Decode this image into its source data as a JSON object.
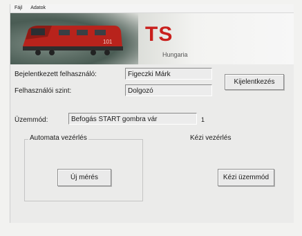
{
  "menu": {
    "items": [
      "Fájl",
      "Adatok"
    ]
  },
  "banner": {
    "logo_text": "TS",
    "subtitle": "Hungaria",
    "train_number": "101"
  },
  "user": {
    "user_label": "Bejelentkezett felhasználó:",
    "user_value": "Figeczki Márk",
    "level_label": "Felhasználói szint:",
    "level_value": "Dolgozó",
    "logout_label": "Kijelentkezés"
  },
  "mode": {
    "label": "Üzemmód:",
    "value": "Befogás START gombra vár",
    "number": "1"
  },
  "auto_group": {
    "title": "Automata vezérlés",
    "new_measure_label": "Új mérés"
  },
  "manual_group": {
    "title": "Kézi vezérlés",
    "manual_mode_label": "Kézi üzemmód"
  },
  "colors": {
    "logo_red": "#c9201d",
    "train_red": "#b8231c"
  }
}
